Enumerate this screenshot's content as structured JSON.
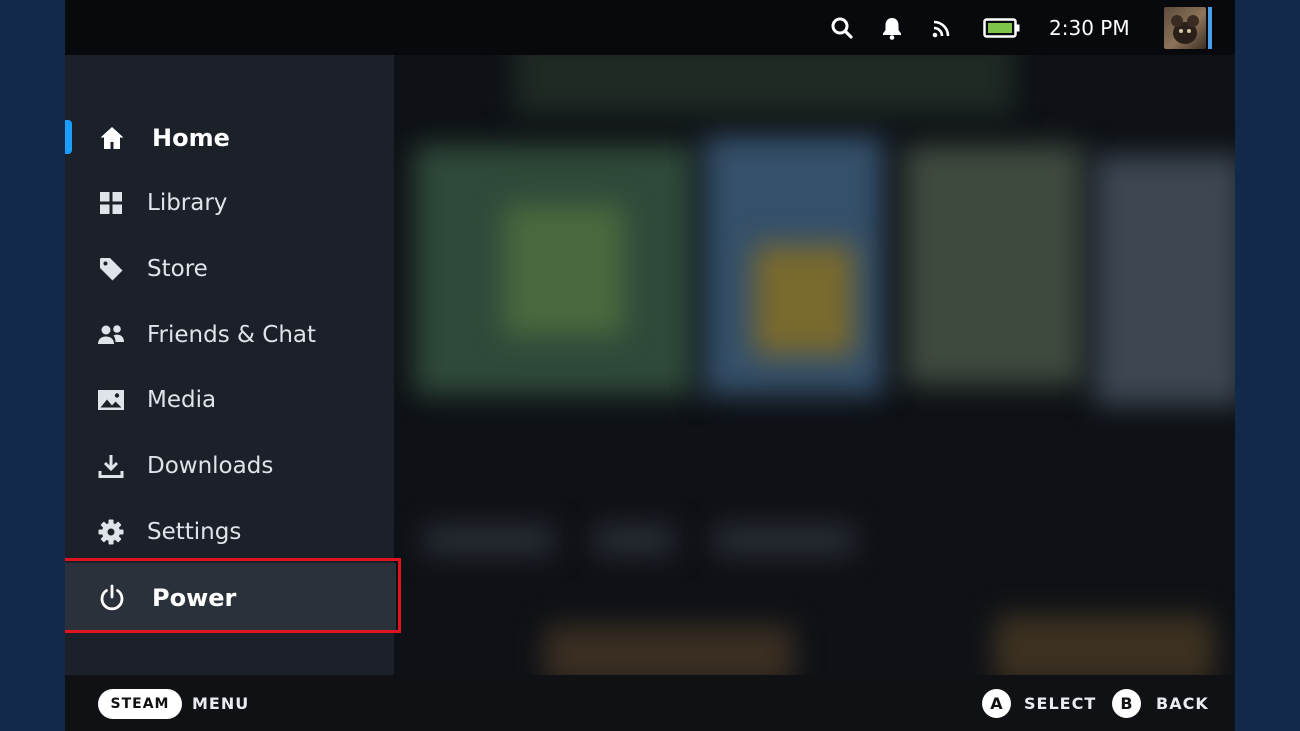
{
  "topbar": {
    "icons": [
      "search-icon",
      "bell-icon",
      "wifi-icon",
      "battery-icon"
    ],
    "time": "2:30 PM",
    "battery_color": "#7ec34a"
  },
  "sidebar": {
    "items": [
      {
        "label": "Home",
        "icon": "home-icon"
      },
      {
        "label": "Library",
        "icon": "grid-icon"
      },
      {
        "label": "Store",
        "icon": "tag-icon"
      },
      {
        "label": "Friends & Chat",
        "icon": "people-icon"
      },
      {
        "label": "Media",
        "icon": "image-icon"
      },
      {
        "label": "Downloads",
        "icon": "download-icon"
      },
      {
        "label": "Settings",
        "icon": "gear-icon"
      },
      {
        "label": "Power",
        "icon": "power-icon"
      }
    ],
    "active_color": "#1a9fff",
    "highlight_color": "#e0141e"
  },
  "footer": {
    "steam_label": "STEAM",
    "menu_label": "MENU",
    "a_glyph": "A",
    "select_label": "SELECT",
    "b_glyph": "B",
    "back_label": "BACK"
  }
}
